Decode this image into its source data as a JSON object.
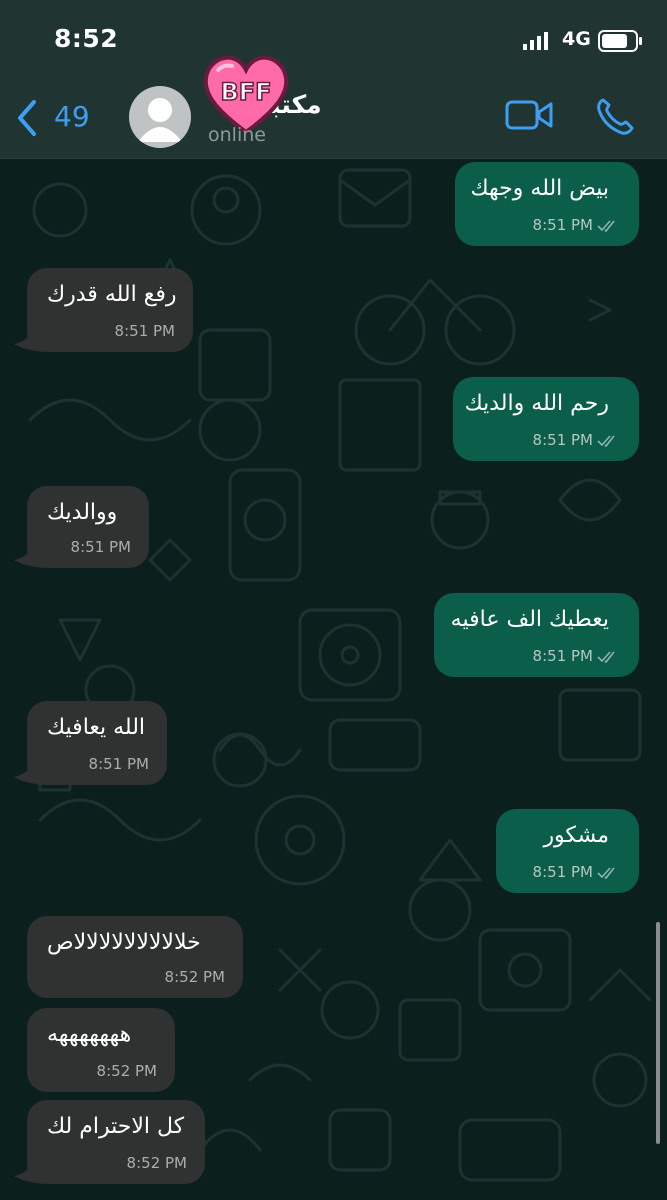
{
  "status_bar": {
    "time": "8:52",
    "network": "4G"
  },
  "header": {
    "back_count": "49",
    "contact_name": "مكتبه",
    "badge_text": "BFF",
    "contact_status": "online"
  },
  "messages": [
    {
      "direction": "out",
      "text": "بيض الله وجهك",
      "time": "8:51 PM"
    },
    {
      "direction": "in",
      "text": "رفع الله قدرك",
      "time": "8:51 PM"
    },
    {
      "direction": "out",
      "text": "رحم الله والديك",
      "time": "8:51 PM"
    },
    {
      "direction": "in",
      "text": "ووالديك",
      "time": "8:51 PM"
    },
    {
      "direction": "out",
      "text": "يعطيك الف عافيه",
      "time": "8:51 PM"
    },
    {
      "direction": "in",
      "text": "الله يعافيك",
      "time": "8:51 PM"
    },
    {
      "direction": "out",
      "text": "مشكور",
      "time": "8:51 PM"
    },
    {
      "direction": "in",
      "text": "خلالالالالالالالالاص",
      "time": "8:52 PM"
    },
    {
      "direction": "in",
      "text": "هههههههه",
      "time": "8:52 PM"
    },
    {
      "direction": "in",
      "text": "كل الاحترام لك",
      "time": "8:52 PM"
    }
  ],
  "colors": {
    "accent": "#3d9ef2",
    "outgoing_bubble": "#0a5e4a",
    "incoming_bubble": "#2f3231",
    "header_bg": "#203531",
    "badge": "#ff5fa0"
  }
}
